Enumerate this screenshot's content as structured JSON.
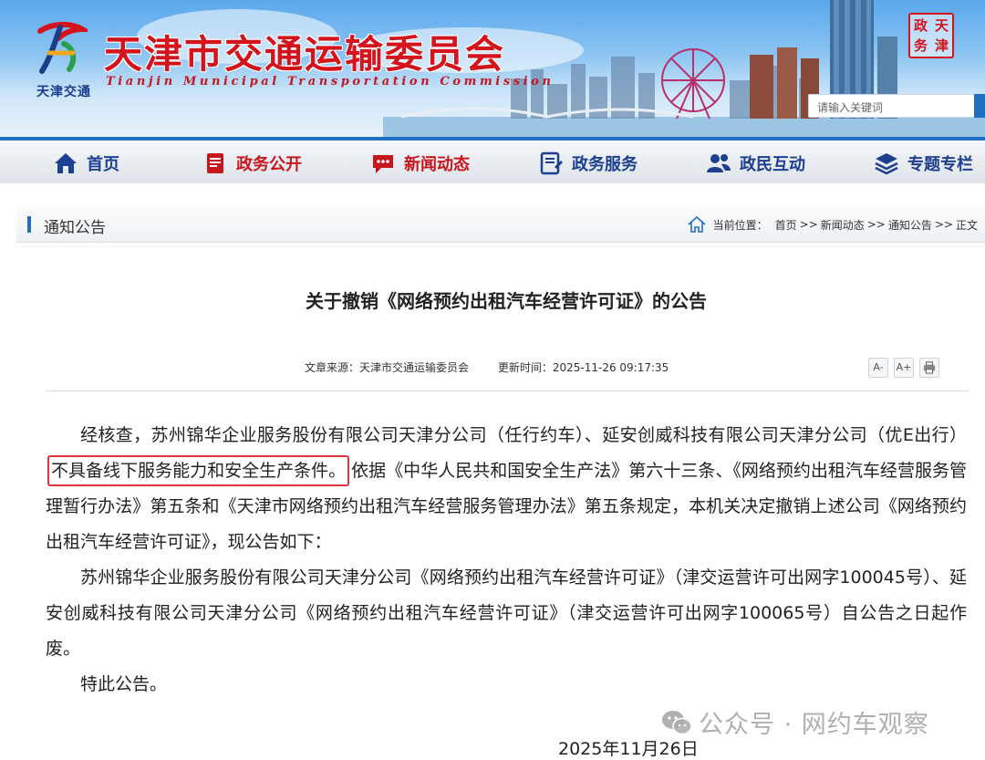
{
  "header": {
    "logo_caption": "天津交通",
    "site_title": "天津市交通运输委员会",
    "site_subtitle": "Tianjin Municipal Transportation Commission",
    "seal_chars": [
      "天",
      "政",
      "津",
      "务"
    ],
    "search_placeholder": "请输入关键词"
  },
  "nav": {
    "items": [
      {
        "label": "首页",
        "icon": "home-icon"
      },
      {
        "label": "政务公开",
        "icon": "document-icon"
      },
      {
        "label": "新闻动态",
        "icon": "chat-icon"
      },
      {
        "label": "政务服务",
        "icon": "form-icon"
      },
      {
        "label": "政民互动",
        "icon": "people-icon"
      },
      {
        "label": "专题专栏",
        "icon": "layers-icon"
      }
    ]
  },
  "section": {
    "title": "通知公告",
    "breadcrumb_label": "当前位置：",
    "breadcrumb": [
      "首页",
      "新闻动态",
      "通知公告",
      "正文"
    ],
    "breadcrumb_separator": ">>"
  },
  "article": {
    "title": "关于撤销《网络预约出租汽车经营许可证》的公告",
    "source": "文章来源：天津市交通运输委员会",
    "updated": "更新时间：2025-11-26 09:17:35",
    "tools": [
      "A-",
      "A+",
      "print"
    ],
    "paragraph1_before": "经核查，苏州锦华企业服务股份有限公司天津分公司（任行约车）、延安创威科技有限公司天津分公司（优E出行）",
    "paragraph1_highlight": "不具备线下服务能力和安全生产条件。",
    "paragraph1_after": "依据《中华人民共和国安全生产法》第六十三条、《网络预约出租汽车经营服务管理暂行办法》第五条和《天津市网络预约出租汽车经营服务管理办法》第五条规定，本机关决定撤销上述公司《网络预约出租汽车经营许可证》，现公告如下：",
    "paragraph2": "苏州锦华企业服务股份有限公司天津分公司《网络预约出租汽车经营许可证》（津交运营许可出网字100045号）、延安创威科技有限公司天津分公司《网络预约出租汽车经营许可证》（津交运营许可出网字100065号）自公告之日起作废。",
    "paragraph3": "特此公告。",
    "date": "2025年11月26日"
  },
  "watermark": {
    "text": "公众号 · 网约车观察",
    "icon": "wechat-icon"
  },
  "colors": {
    "brand_red": "#d4141c",
    "brand_blue": "#1f6fc2",
    "nav_text_blue": "#1d3f8f",
    "highlight_box": "#e0353e"
  }
}
